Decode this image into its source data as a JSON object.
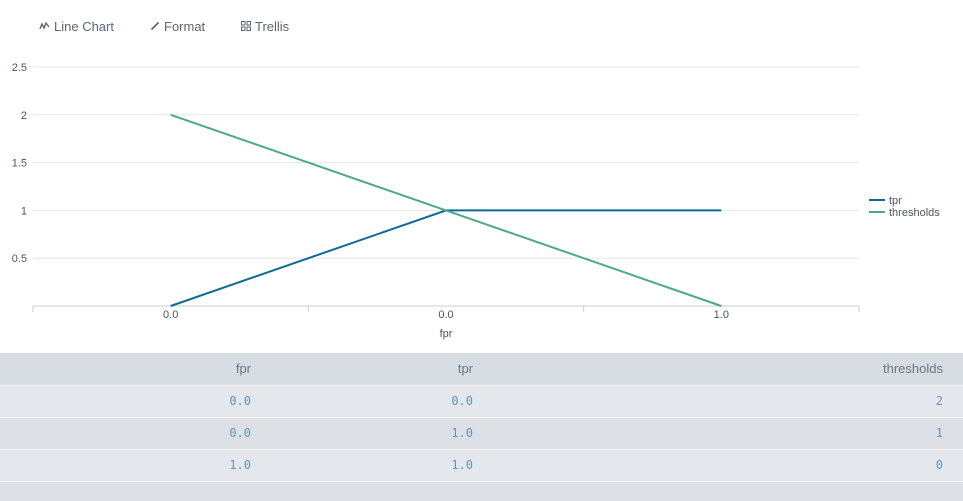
{
  "toolbar": {
    "line_chart_label": "Line Chart",
    "format_label": "Format",
    "trellis_label": "Trellis"
  },
  "chart_data": {
    "type": "line",
    "x": [
      "0.0",
      "0.0",
      "1.0"
    ],
    "xlabel": "fpr",
    "ylabel": "",
    "ylim": [
      0,
      2.5
    ],
    "yticks": [
      "0.5",
      "1",
      "1.5",
      "2",
      "2.5"
    ],
    "series": [
      {
        "name": "tpr",
        "values": [
          0,
          1,
          1
        ],
        "color": "#0e6b96"
      },
      {
        "name": "thresholds",
        "values": [
          2,
          1,
          0
        ],
        "color": "#4ea985"
      }
    ],
    "grid": true,
    "legend": "right"
  },
  "table": {
    "headers": [
      "fpr",
      "tpr",
      "thresholds"
    ],
    "rows": [
      [
        "0.0",
        "0.0",
        "2"
      ],
      [
        "0.0",
        "1.0",
        "1"
      ],
      [
        "1.0",
        "1.0",
        "0"
      ]
    ]
  }
}
